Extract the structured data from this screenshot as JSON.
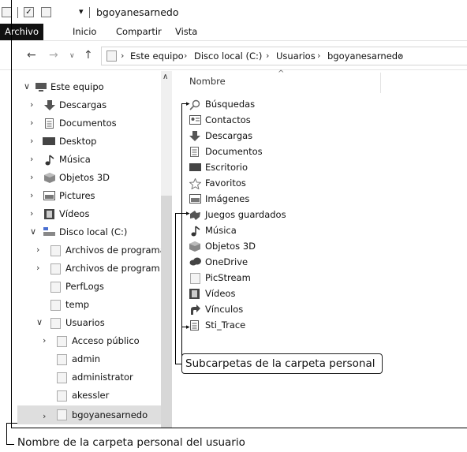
{
  "window": {
    "title": "bgoyanesarnedo"
  },
  "ribbon": {
    "tabs": [
      {
        "label": "Archivo"
      },
      {
        "label": "Inicio"
      },
      {
        "label": "Compartir"
      },
      {
        "label": "Vista"
      }
    ]
  },
  "address_bar": {
    "segments": [
      "Este equipo",
      "Disco local (C:)",
      "Usuarios",
      "bgoyanesarnedo"
    ]
  },
  "nav_pane": {
    "items": [
      {
        "label": "Este equipo",
        "icon": "computer-icon",
        "expanded": true
      },
      {
        "label": "Descargas",
        "icon": "download-arrow-icon"
      },
      {
        "label": "Documentos",
        "icon": "document-icon"
      },
      {
        "label": "Desktop",
        "icon": "desktop-icon"
      },
      {
        "label": "Música",
        "icon": "music-note-icon"
      },
      {
        "label": "Objetos 3D",
        "icon": "cube-icon"
      },
      {
        "label": "Pictures",
        "icon": "picture-icon"
      },
      {
        "label": "Vídeos",
        "icon": "film-icon"
      },
      {
        "label": "Disco local (C:)",
        "icon": "drive-icon",
        "expanded": true
      },
      {
        "label": "Archivos de programa",
        "icon": "folder-icon"
      },
      {
        "label": "Archivos de programa (:",
        "icon": "folder-icon"
      },
      {
        "label": "PerfLogs",
        "icon": "folder-icon"
      },
      {
        "label": "temp",
        "icon": "folder-icon"
      },
      {
        "label": "Usuarios",
        "icon": "folder-icon",
        "expanded": true
      },
      {
        "label": "Acceso público",
        "icon": "folder-icon"
      },
      {
        "label": "admin",
        "icon": "folder-icon"
      },
      {
        "label": "administrator",
        "icon": "folder-icon"
      },
      {
        "label": "akessler",
        "icon": "folder-icon"
      },
      {
        "label": "bgoyanesarnedo",
        "icon": "folder-icon",
        "selected": true
      }
    ]
  },
  "content": {
    "column_header": "Nombre",
    "items": [
      {
        "label": "Búsquedas",
        "icon": "search-icon"
      },
      {
        "label": "Contactos",
        "icon": "contacts-icon"
      },
      {
        "label": "Descargas",
        "icon": "download-arrow-icon"
      },
      {
        "label": "Documentos",
        "icon": "document-icon"
      },
      {
        "label": "Escritorio",
        "icon": "desktop-icon"
      },
      {
        "label": "Favoritos",
        "icon": "star-icon"
      },
      {
        "label": "Imágenes",
        "icon": "picture-icon"
      },
      {
        "label": "Juegos guardados",
        "icon": "puzzle-icon"
      },
      {
        "label": "Música",
        "icon": "music-note-icon"
      },
      {
        "label": "Objetos 3D",
        "icon": "cube-icon"
      },
      {
        "label": "OneDrive",
        "icon": "cloud-icon"
      },
      {
        "label": "PicStream",
        "icon": "folder-icon"
      },
      {
        "label": "Vídeos",
        "icon": "film-icon"
      },
      {
        "label": "Vínculos",
        "icon": "link-arrow-icon"
      },
      {
        "label": "Sti_Trace",
        "icon": "text-file-icon"
      }
    ]
  },
  "callouts": {
    "subfolders": "Subcarpetas de la carpeta personal",
    "personal_folder": "Nombre de la carpeta personal del usuario"
  }
}
